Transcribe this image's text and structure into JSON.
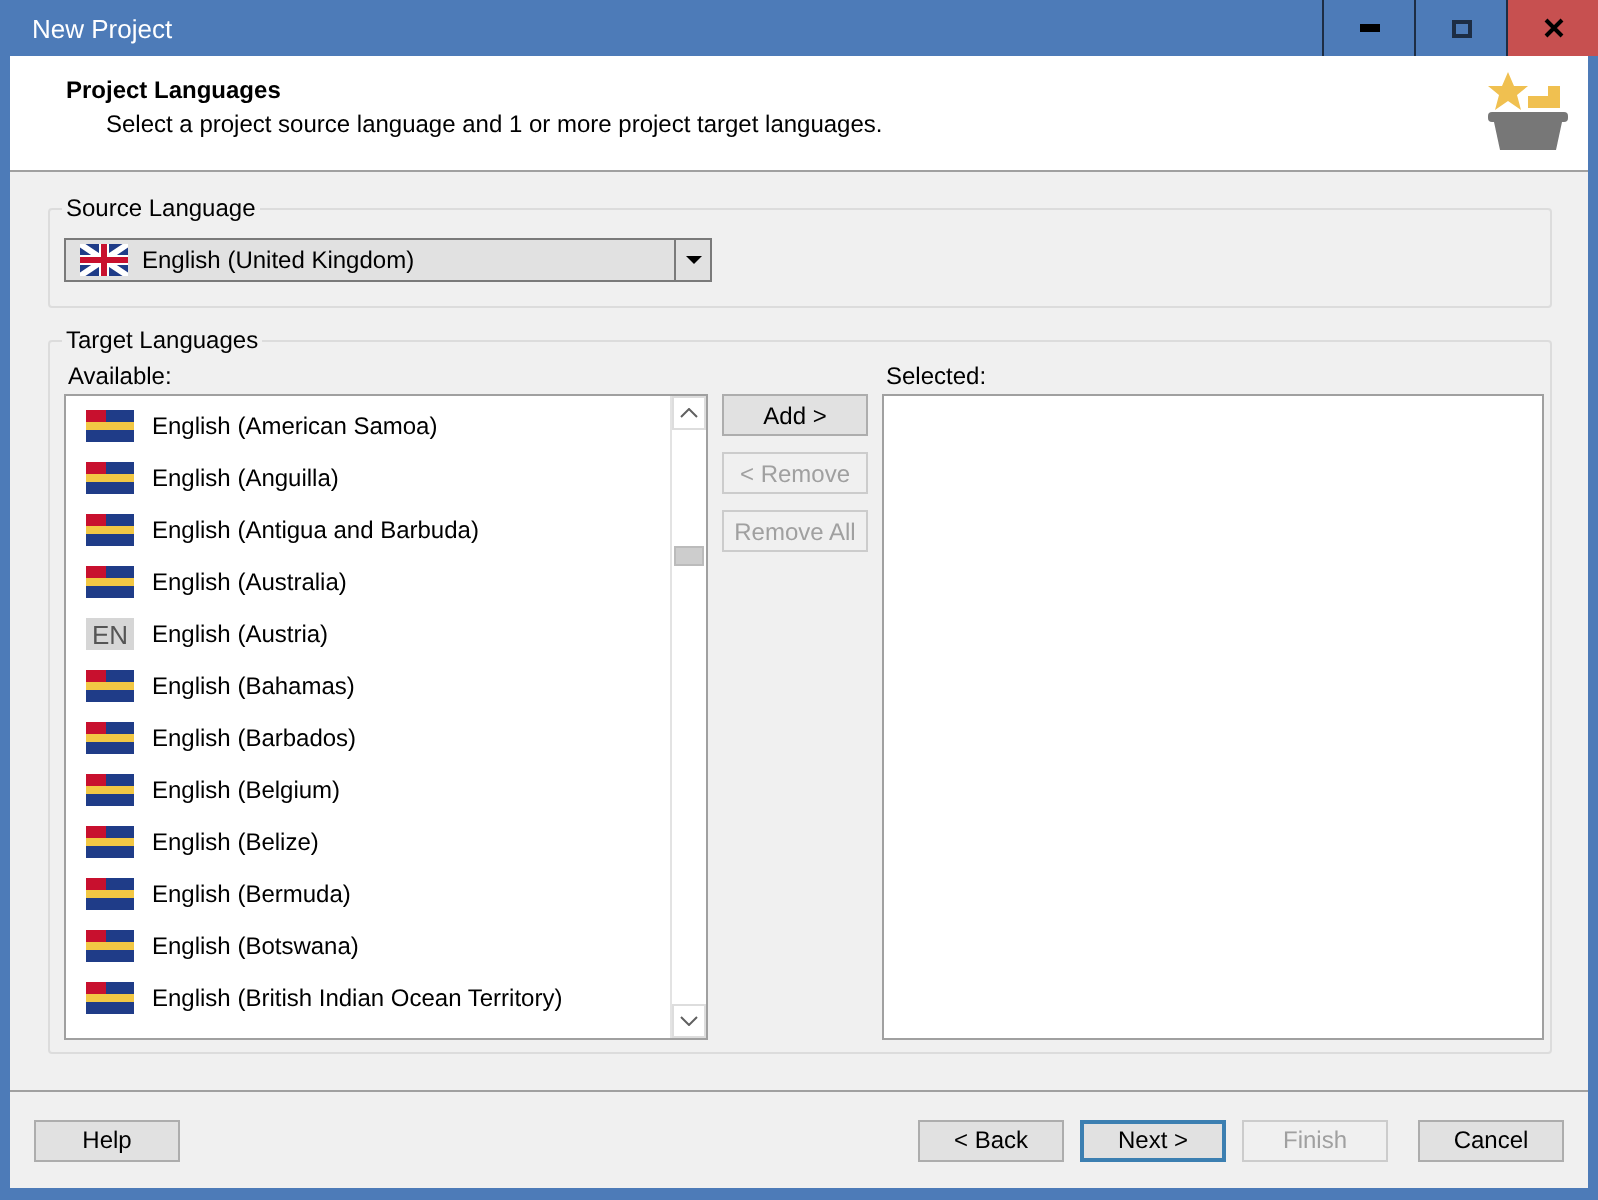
{
  "window": {
    "title": "New Project"
  },
  "header": {
    "title": "Project Languages",
    "subtitle": "Select a project source language and 1 or more project target languages."
  },
  "source_language": {
    "label": "Source Language",
    "value": "English (United Kingdom)"
  },
  "target_languages": {
    "label": "Target Languages",
    "available_label": "Available:",
    "selected_label": "Selected:",
    "available": [
      {
        "name": "English (American Samoa)",
        "kind": "flag"
      },
      {
        "name": "English (Anguilla)",
        "kind": "flag"
      },
      {
        "name": "English (Antigua and Barbuda)",
        "kind": "flag"
      },
      {
        "name": "English (Australia)",
        "kind": "flag"
      },
      {
        "name": "English (Austria)",
        "kind": "code",
        "code": "EN"
      },
      {
        "name": "English (Bahamas)",
        "kind": "flag"
      },
      {
        "name": "English (Barbados)",
        "kind": "flag"
      },
      {
        "name": "English (Belgium)",
        "kind": "flag"
      },
      {
        "name": "English (Belize)",
        "kind": "flag"
      },
      {
        "name": "English (Bermuda)",
        "kind": "flag"
      },
      {
        "name": "English (Botswana)",
        "kind": "flag"
      },
      {
        "name": "English (British Indian Ocean Territory)",
        "kind": "flag"
      }
    ],
    "actions": [
      {
        "label": "Add >",
        "disabled": false
      },
      {
        "label": "< Remove",
        "disabled": true
      },
      {
        "label": "Remove All",
        "disabled": true
      }
    ]
  },
  "footer": {
    "help": {
      "label": "Help",
      "disabled": false
    },
    "buttons": [
      {
        "label": "< Back",
        "disabled": false,
        "default": false
      },
      {
        "label": "Next >",
        "disabled": false,
        "default": true
      },
      {
        "label": "Finish",
        "disabled": true,
        "default": false
      },
      {
        "label": "Cancel",
        "disabled": false,
        "default": false
      }
    ]
  }
}
